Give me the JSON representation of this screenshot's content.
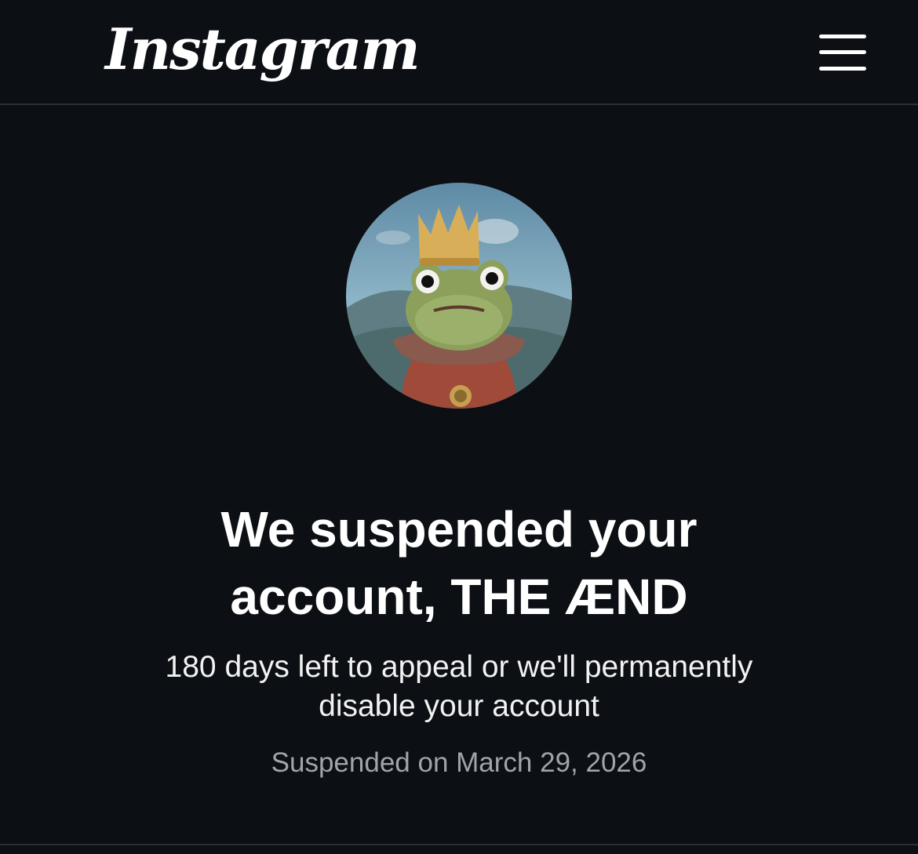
{
  "header": {
    "logo_text": "Instagram",
    "menu_icon": "hamburger-menu-icon"
  },
  "profile": {
    "avatar_description_icon": "avatar-image"
  },
  "notice": {
    "title_line1": "We suspended your",
    "title_line2": "account, THE ÆND",
    "subtitle_line1": "180 days left to appeal or we'll permanently",
    "subtitle_line2": "disable your account",
    "suspended_date": "Suspended on March 29, 2026"
  },
  "colors": {
    "background": "#0c0f14",
    "text_primary": "#ffffff",
    "text_secondary": "#a0a4ab",
    "divider": "#2b2f36"
  }
}
